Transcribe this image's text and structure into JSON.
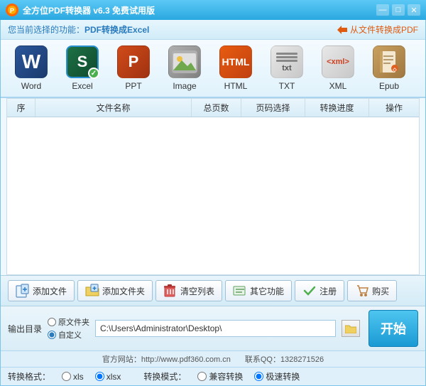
{
  "titleBar": {
    "title": "全方位PDF转换器 v6.3 免费试用版",
    "minimize": "—",
    "maximize": "□",
    "close": "✕"
  },
  "topBar": {
    "prefix": "您当前选择的功能：",
    "function": "PDF转换成Excel",
    "switchText": "从文件转换成PDF"
  },
  "tools": [
    {
      "id": "word",
      "label": "Word",
      "selected": false
    },
    {
      "id": "excel",
      "label": "Excel",
      "selected": true
    },
    {
      "id": "ppt",
      "label": "PPT",
      "selected": false
    },
    {
      "id": "image",
      "label": "Image",
      "selected": false
    },
    {
      "id": "html",
      "label": "HTML",
      "selected": false
    },
    {
      "id": "txt",
      "label": "TXT",
      "selected": false
    },
    {
      "id": "xml",
      "label": "XML",
      "selected": false
    },
    {
      "id": "epub",
      "label": "Epub",
      "selected": false
    }
  ],
  "table": {
    "headers": [
      "序",
      "文件名称",
      "总页数",
      "页码选择",
      "转换进度",
      "操作"
    ]
  },
  "bottomButtons": [
    {
      "id": "add-file",
      "label": "添加文件"
    },
    {
      "id": "add-folder",
      "label": "添加文件夹"
    },
    {
      "id": "clear-list",
      "label": "清空列表"
    },
    {
      "id": "other-func",
      "label": "其它功能"
    },
    {
      "id": "register",
      "label": "注册"
    },
    {
      "id": "buy",
      "label": "购买"
    }
  ],
  "outputDir": {
    "label": "输出目录",
    "option1": "原文件夹",
    "option2": "自定义",
    "path": "C:\\Users\\Administrator\\Desktop\\",
    "folderIcon": "📁"
  },
  "startButton": "开始",
  "websiteRow": {
    "site": "官方网站：http://www.pdf360.com.cn",
    "contact": "联系QQ：1328271526"
  },
  "formatRow": {
    "formatLabel": "转换格式：",
    "formats": [
      {
        "id": "xls",
        "label": "xls",
        "checked": false
      },
      {
        "id": "xlsx",
        "label": "xlsx",
        "checked": true
      }
    ],
    "modeLabel": "转换模式：",
    "modes": [
      {
        "id": "compatible",
        "label": "兼容转换",
        "checked": false
      },
      {
        "id": "fast",
        "label": "极速转换",
        "checked": true
      }
    ]
  }
}
